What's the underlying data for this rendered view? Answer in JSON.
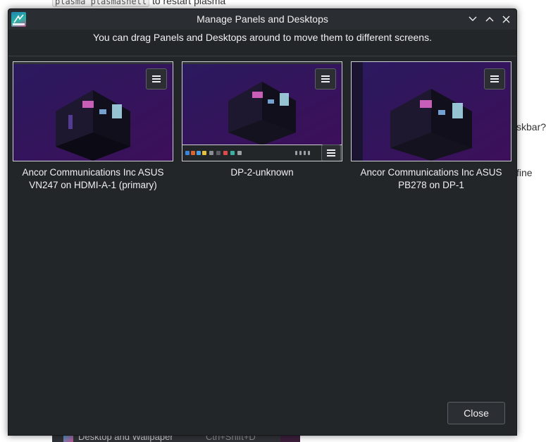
{
  "background": {
    "top_line_code": "plasma plasmashell",
    "top_line_text": "to restart plasma",
    "fragment_1": "skbar?",
    "fragment_2": "fine",
    "menu_item_label": "Desktop and Wallpaper",
    "menu_item_shortcut": "Ctrl+Shift+D"
  },
  "dialog": {
    "title": "Manage Panels and Desktops",
    "header_text": "You can drag Panels and Desktops around to move them to different screens.",
    "close_label": "Close",
    "colors": {
      "window_bg": "#232629",
      "titlebar_bg": "#2a2e32",
      "text": "#eff0f1",
      "thumb_border": "#cfd0d2"
    }
  },
  "screens": [
    {
      "label": "Ancor Communications Inc ASUS VN247 on HDMI-A-1 (primary)",
      "has_bottom_panel": false,
      "menu_icon": "hamburger-menu-icon"
    },
    {
      "label": "DP-2-unknown",
      "has_bottom_panel": true,
      "menu_icon": "hamburger-menu-icon"
    },
    {
      "label": "Ancor Communications Inc ASUS PB278 on DP-1",
      "has_bottom_panel": false,
      "menu_icon": "hamburger-menu-icon"
    }
  ],
  "titlebar_buttons": [
    "minimize-icon",
    "maximize-icon",
    "close-icon"
  ]
}
